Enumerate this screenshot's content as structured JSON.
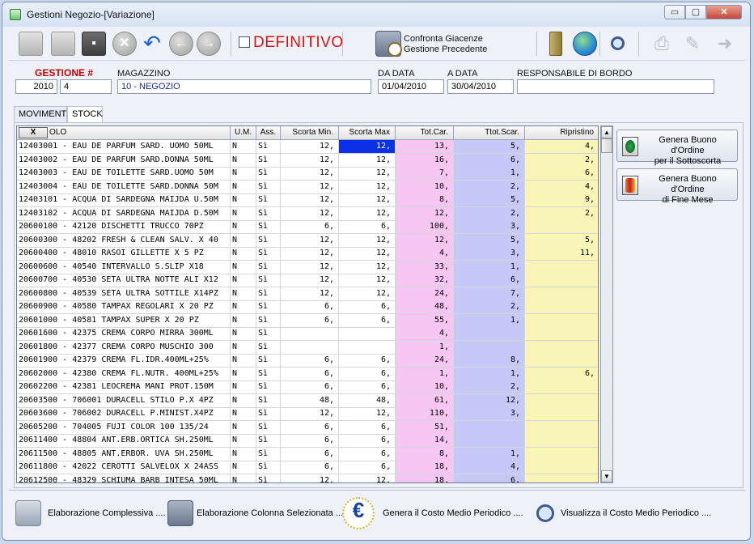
{
  "window": {
    "title": "Gestioni Negozio-[Variazione]",
    "minimize": "▭",
    "maximize": "▢",
    "close": "✕"
  },
  "toolbar": {
    "definitivo_label": "DEFINITIVO",
    "confronta_line1": "Confronta Giacenze",
    "confronta_line2": "Gestione Precedente",
    "icons": [
      "open-folder-icon",
      "open-folder-2-icon",
      "save-icon",
      "cancel-icon",
      "undo-icon",
      "back-icon",
      "forward-icon",
      "clock-compare-icon",
      "pencil-icon",
      "globe-icon",
      "search-icon",
      "print-icon",
      "edit-icon",
      "exit-icon"
    ]
  },
  "header": {
    "gestione_label": "GESTIONE #",
    "gestione_year": "2010",
    "gestione_num": "4",
    "magazzino_label": "MAGAZZINO",
    "magazzino_value": "10 - NEGOZIO",
    "da_data_label": "DA DATA",
    "da_data_value": "01/04/2010",
    "a_data_label": "A DATA",
    "a_data_value": "30/04/2010",
    "responsabile_label": "RESPONSABILE DI BORDO",
    "responsabile_value": ""
  },
  "tabs": [
    {
      "label": "MOVIMENTI"
    },
    {
      "label": "STOCK"
    }
  ],
  "active_tab": "STOCK",
  "grid": {
    "x_button": "X",
    "columns": [
      "OLO",
      "U.M.",
      "Ass.",
      "Scorta Min.",
      "Scorta Max",
      "Tot.Car.",
      "Ttot.Scar.",
      "Ripristino"
    ],
    "column_colors": {
      "tot_car": "#f7c6f2",
      "tot_scar": "#c6c9f7",
      "ripristino": "#f8f5b7",
      "selected": "#0a30e8"
    },
    "selected_cell": {
      "row": 0,
      "column": "Scorta Max"
    },
    "rows": [
      [
        "12403001 - EAU DE PARFUM SARD. UOMO 50ML",
        "N",
        "Sì",
        "12,",
        "12,",
        "13,",
        "5,",
        "4,"
      ],
      [
        "12403002 - EAU DE PARFUM SARD.DONNA 50ML",
        "N",
        "Sì",
        "12,",
        "12,",
        "16,",
        "6,",
        "2,"
      ],
      [
        "12403003 - EAU DE TOILETTE SARD.UOMO 50M",
        "N",
        "Sì",
        "12,",
        "12,",
        "7,",
        "1,",
        "6,"
      ],
      [
        "12403004 - EAU DE TOILETTE SARD.DONNA 50M",
        "N",
        "Sì",
        "12,",
        "12,",
        "10,",
        "2,",
        "4,"
      ],
      [
        "12403101 - ACQUA DI SARDEGNA MAIJDA U.50M",
        "N",
        "Sì",
        "12,",
        "12,",
        "8,",
        "5,",
        "9,"
      ],
      [
        "12403102 - ACQUA DI SARDEGNA MAIJDA D.50M",
        "N",
        "Sì",
        "12,",
        "12,",
        "12,",
        "2,",
        "2,"
      ],
      [
        "20600100 - 42120 DISCHETTI TRUCCO 70PZ",
        "N",
        "Sì",
        "6,",
        "6,",
        "100,",
        "3,",
        ""
      ],
      [
        "20600300 - 48202 FRESH & CLEAN SALV. X 40",
        "N",
        "Sì",
        "12,",
        "12,",
        "12,",
        "5,",
        "5,"
      ],
      [
        "20600400 - 48010 RASOI GILLETTE X 5 PZ",
        "N",
        "Sì",
        "12,",
        "12,",
        "4,",
        "3,",
        "11,"
      ],
      [
        "20600600 - 40540 INTERVALLO S.SLIP X18",
        "N",
        "Sì",
        "12,",
        "12,",
        "33,",
        "1,",
        ""
      ],
      [
        "20600700 - 40530 SETA ULTRA NOTTE ALI X12",
        "N",
        "Sì",
        "12,",
        "12,",
        "32,",
        "6,",
        ""
      ],
      [
        "20600800 - 40539 SETA ULTRA SOTTILE X14PZ",
        "N",
        "Sì",
        "12,",
        "12,",
        "24,",
        "7,",
        ""
      ],
      [
        "20600900 - 40580 TAMPAX REGOLARI X 20 PZ",
        "N",
        "Sì",
        "6,",
        "6,",
        "48,",
        "2,",
        ""
      ],
      [
        "20601000 - 40581 TAMPAX SUPER X 20 PZ",
        "N",
        "Sì",
        "6,",
        "6,",
        "55,",
        "1,",
        ""
      ],
      [
        "20601600 - 42375 CREMA CORPO MIRRA 300ML",
        "N",
        "Sì",
        "",
        "",
        "4,",
        "",
        ""
      ],
      [
        "20601800 - 42377 CREMA CORPO MUSCHIO 300",
        "N",
        "Sì",
        "",
        "",
        "1,",
        "",
        ""
      ],
      [
        "20601900 - 42379 CREMA FL.IDR.400ML+25%",
        "N",
        "Sì",
        "6,",
        "6,",
        "24,",
        "8,",
        ""
      ],
      [
        "20602000 - 42380 CREMA FL.NUTR. 400ML+25%",
        "N",
        "Sì",
        "6,",
        "6,",
        "1,",
        "1,",
        "6,"
      ],
      [
        "20602200 - 42381 LEOCREMA MANI PROT.150M",
        "N",
        "Sì",
        "6,",
        "6,",
        "10,",
        "2,",
        ""
      ],
      [
        "20603500 - 706001 DURACELL STILO P.X 4PZ",
        "N",
        "Sì",
        "48,",
        "48,",
        "61,",
        "12,",
        ""
      ],
      [
        "20603600 - 706002 DURACELL P.MINIST.X4PZ",
        "N",
        "Sì",
        "12,",
        "12,",
        "110,",
        "3,",
        ""
      ],
      [
        "20605200 - 704005 FUJI COLOR 100 135/24",
        "N",
        "Sì",
        "6,",
        "6,",
        "51,",
        "",
        ""
      ],
      [
        "20611400 - 48804 ANT.ERB.ORTICA SH.250ML",
        "N",
        "Sì",
        "6,",
        "6,",
        "14,",
        "",
        ""
      ],
      [
        "20611500 - 48805 ANT.ERBOR. UVA SH.250ML",
        "N",
        "Sì",
        "6,",
        "6,",
        "8,",
        "1,",
        ""
      ],
      [
        "20611800 - 42022 CEROTTI SALVELOX X 24ASS",
        "N",
        "Sì",
        "6,",
        "6,",
        "18,",
        "4,",
        ""
      ],
      [
        "20612500 - 48329 SCHIUMA BARB INTESA 50ML",
        "N",
        "Sì",
        "12,",
        "12,",
        "18,",
        "6,",
        ""
      ]
    ]
  },
  "side_buttons": [
    {
      "line1": "Genera Buono d'Ordine",
      "line2": "per il Sottoscorta"
    },
    {
      "line1": "Genera Buono d'Ordine",
      "line2": "di Fine Mese"
    }
  ],
  "footer": [
    {
      "label": "Elaborazione Complessiva ...."
    },
    {
      "label": "Elaborazione Colonna Selezionata ...."
    },
    {
      "label": "Genera il Costo Medio Periodico ...."
    },
    {
      "label": "Visualizza il Costo Medio Periodico ...."
    }
  ]
}
